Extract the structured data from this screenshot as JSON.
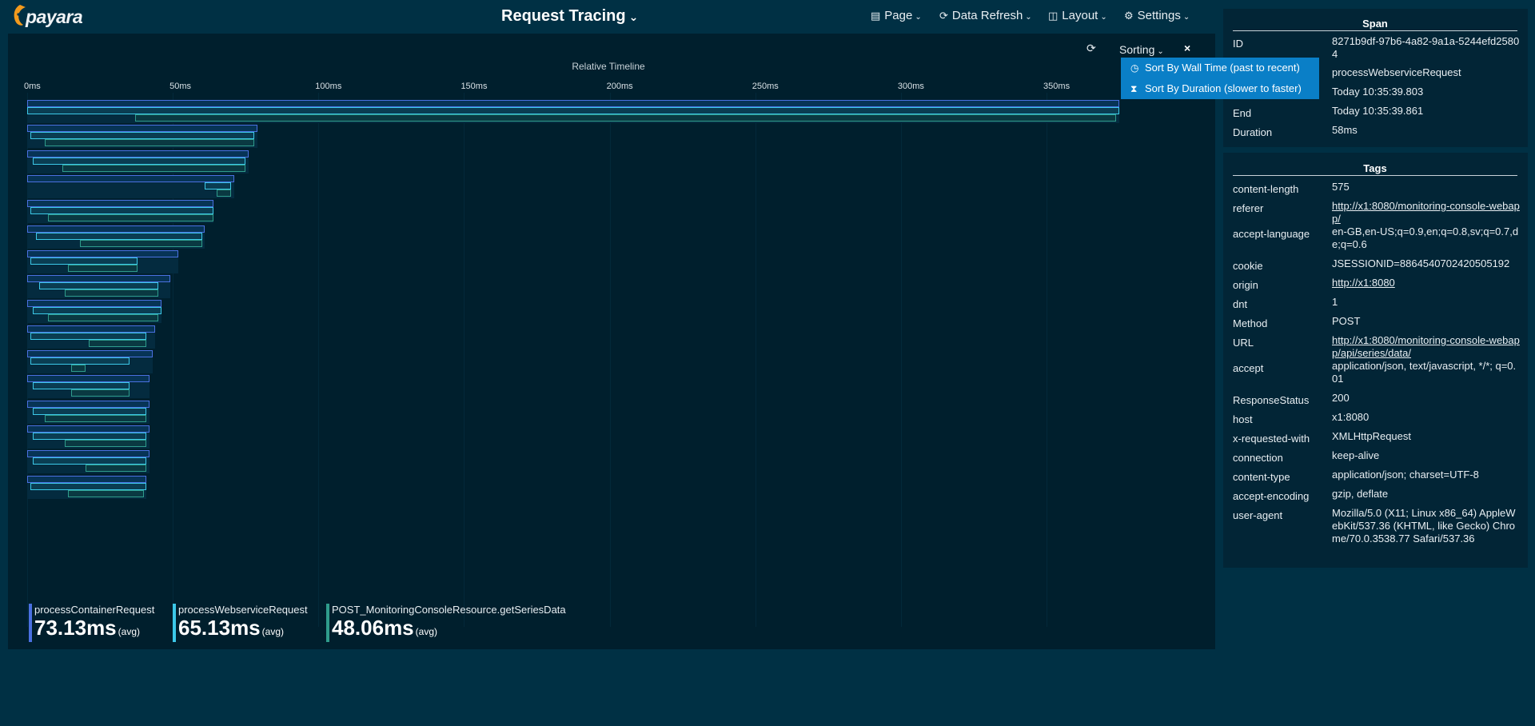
{
  "header": {
    "logo_text": "payara",
    "title": "Request Tracing",
    "menus": [
      {
        "label": "Page",
        "icon": "page-icon"
      },
      {
        "label": "Data Refresh",
        "icon": "refresh-icon"
      },
      {
        "label": "Layout",
        "icon": "columns-icon"
      },
      {
        "label": "Settings",
        "icon": "gear-icon"
      }
    ]
  },
  "timeline": {
    "title": "Relative Timeline",
    "axis": [
      "0ms",
      "50ms",
      "100ms",
      "150ms",
      "200ms",
      "250ms",
      "300ms",
      "350ms"
    ],
    "axis_max_ms": 375,
    "rows": [
      {
        "container": [
          0,
          375
        ],
        "webservice": [
          0,
          375
        ],
        "post": [
          37,
          374
        ]
      },
      {
        "container": [
          0,
          79
        ],
        "webservice": [
          1,
          78
        ],
        "post": [
          6,
          78
        ]
      },
      {
        "container": [
          0,
          76
        ],
        "webservice": [
          2,
          75
        ],
        "post": [
          12,
          75
        ]
      },
      {
        "container": [
          0,
          71
        ],
        "webservice": [
          61,
          70
        ],
        "post": [
          65,
          70
        ]
      },
      {
        "container": [
          0,
          64
        ],
        "webservice": [
          1,
          64
        ],
        "post": [
          7,
          64
        ]
      },
      {
        "container": [
          0,
          61
        ],
        "webservice": [
          3,
          60
        ],
        "post": [
          18,
          60
        ]
      },
      {
        "container": [
          0,
          52
        ],
        "webservice": [
          1,
          38
        ],
        "post": [
          14,
          38
        ]
      },
      {
        "container": [
          0,
          49
        ],
        "webservice": [
          4,
          45
        ],
        "post": [
          13,
          45
        ]
      },
      {
        "container": [
          0,
          46
        ],
        "webservice": [
          2,
          46
        ],
        "post": [
          7,
          45
        ]
      },
      {
        "container": [
          0,
          44
        ],
        "webservice": [
          1,
          41
        ],
        "post": [
          21,
          41
        ]
      },
      {
        "container": [
          0,
          43
        ],
        "webservice": [
          1,
          35
        ],
        "post": [
          15,
          20
        ]
      },
      {
        "container": [
          0,
          42
        ],
        "webservice": [
          2,
          35
        ],
        "post": [
          15,
          35
        ]
      },
      {
        "container": [
          0,
          42
        ],
        "webservice": [
          2,
          41
        ],
        "post": [
          6,
          41
        ]
      },
      {
        "container": [
          0,
          42
        ],
        "webservice": [
          2,
          41
        ],
        "post": [
          13,
          41
        ]
      },
      {
        "container": [
          0,
          42
        ],
        "webservice": [
          2,
          41
        ],
        "post": [
          20,
          41
        ]
      },
      {
        "container": [
          0,
          41
        ],
        "webservice": [
          1,
          41
        ],
        "post": [
          14,
          40
        ]
      }
    ],
    "sorting_label": "Sorting",
    "close_label": "×",
    "sort_options": [
      {
        "label": "Sort By Wall Time (past to recent)",
        "icon": "clock-icon"
      },
      {
        "label": "Sort By Duration (slower to faster)",
        "icon": "hourglass-icon"
      }
    ]
  },
  "legend": [
    {
      "name": "processContainerRequest",
      "value": "73.13ms",
      "unit": "(avg)",
      "color": "#4a70e0"
    },
    {
      "name": "processWebserviceRequest",
      "value": "65.13ms",
      "unit": "(avg)",
      "color": "#3cc8e8"
    },
    {
      "name": "POST_MonitoringConsoleResource.getSeriesData",
      "value": "48.06ms",
      "unit": "(avg)",
      "color": "#2f9c8c"
    }
  ],
  "span": {
    "title": "Span",
    "fields": [
      {
        "key": "ID",
        "value": "8271b9df-97b6-4a82-9a1a-5244efd25804"
      },
      {
        "key": "",
        "value": "processWebserviceRequest"
      },
      {
        "key": "",
        "value": "Today 10:35:39.803"
      },
      {
        "key": "End",
        "value": "Today 10:35:39.861"
      },
      {
        "key": "Duration",
        "value": "58ms"
      }
    ]
  },
  "tags": {
    "title": "Tags",
    "fields": [
      {
        "key": "content-length",
        "value": "575"
      },
      {
        "key": "referer",
        "value": "http://x1:8080/monitoring-console-webapp/",
        "link": true
      },
      {
        "key": "accept-language",
        "value": "en-GB,en-US;q=0.9,en;q=0.8,sv;q=0.7,de;q=0.6"
      },
      {
        "key": "cookie",
        "value": "JSESSIONID=8864540702420505192"
      },
      {
        "key": "origin",
        "value": "http://x1:8080",
        "link": true
      },
      {
        "key": "dnt",
        "value": "1"
      },
      {
        "key": "Method",
        "value": "POST"
      },
      {
        "key": "URL",
        "value": "http://x1:8080/monitoring-console-webapp/api/series/data/",
        "link": true
      },
      {
        "key": "accept",
        "value": "application/json, text/javascript, */*; q=0.01"
      },
      {
        "key": "ResponseStatus",
        "value": "200"
      },
      {
        "key": "host",
        "value": "x1:8080"
      },
      {
        "key": "x-requested-with",
        "value": "XMLHttpRequest"
      },
      {
        "key": "connection",
        "value": "keep-alive"
      },
      {
        "key": "content-type",
        "value": "application/json; charset=UTF-8"
      },
      {
        "key": "accept-encoding",
        "value": "gzip, deflate"
      },
      {
        "key": "user-agent",
        "value": "Mozilla/5.0 (X11; Linux x86_64) AppleWebKit/537.36 (KHTML, like Gecko) Chrome/70.0.3538.77 Safari/537.36"
      }
    ]
  }
}
